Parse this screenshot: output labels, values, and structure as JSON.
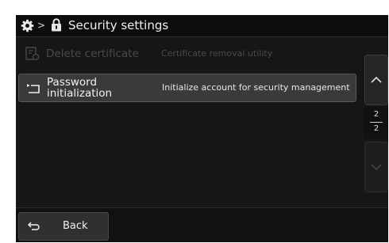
{
  "header": {
    "title": "Security settings",
    "breadcrumb_separator": ">",
    "icons": [
      "gear-icon",
      "lock-icon"
    ]
  },
  "items": [
    {
      "name": "Delete certificate",
      "description": "Certificate removal utility",
      "icon": "certificate-icon",
      "enabled": false
    },
    {
      "name": "Password initialization",
      "description": "Initialize account for security management",
      "icon": "reset-icon",
      "enabled": true
    }
  ],
  "pagination": {
    "current": "2",
    "total": "2"
  },
  "footer": {
    "back_label": "Back"
  },
  "colors": {
    "screen_background": "#161616",
    "disabled_text": "#4a4a4a",
    "active_item_background": "#3a3a3a"
  }
}
